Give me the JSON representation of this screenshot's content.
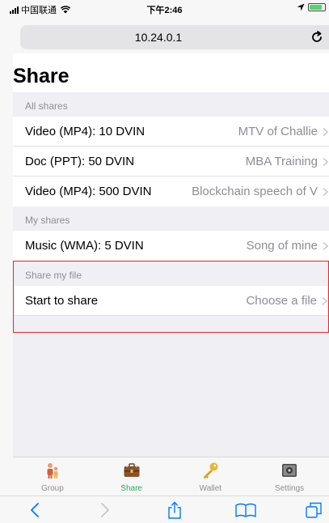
{
  "status_bar": {
    "carrier": "中国联通",
    "time": "下午2:46",
    "battery_level": 0.85
  },
  "address_bar": {
    "url": "10.24.0.1"
  },
  "page": {
    "title": "Share",
    "sections": [
      {
        "header": "All shares",
        "rows": [
          {
            "title": "Video (MP4): 10 DVIN",
            "detail": "MTV of Challie"
          },
          {
            "title": "Doc (PPT): 50 DVIN",
            "detail": "MBA Training"
          },
          {
            "title": "Video (MP4): 500 DVIN",
            "detail": "Blockchain speech of V"
          }
        ]
      },
      {
        "header": "My shares",
        "rows": [
          {
            "title": "Music (WMA): 5 DVIN",
            "detail": "Song of mine"
          }
        ]
      },
      {
        "header": "Share my file",
        "rows": [
          {
            "title": "Start to share",
            "detail": "Choose a file"
          }
        ]
      }
    ]
  },
  "tab_bar": {
    "tabs": [
      {
        "label": "Group",
        "icon": "group-icon"
      },
      {
        "label": "Share",
        "icon": "briefcase-icon",
        "active": true
      },
      {
        "label": "Wallet",
        "icon": "key-icon"
      },
      {
        "label": "Settings",
        "icon": "settings-icon"
      }
    ]
  },
  "colors": {
    "accent": "#27ae60",
    "highlight_border": "#e8232a",
    "ios_blue": "#007aff",
    "secondary_text": "#8e8e93"
  }
}
